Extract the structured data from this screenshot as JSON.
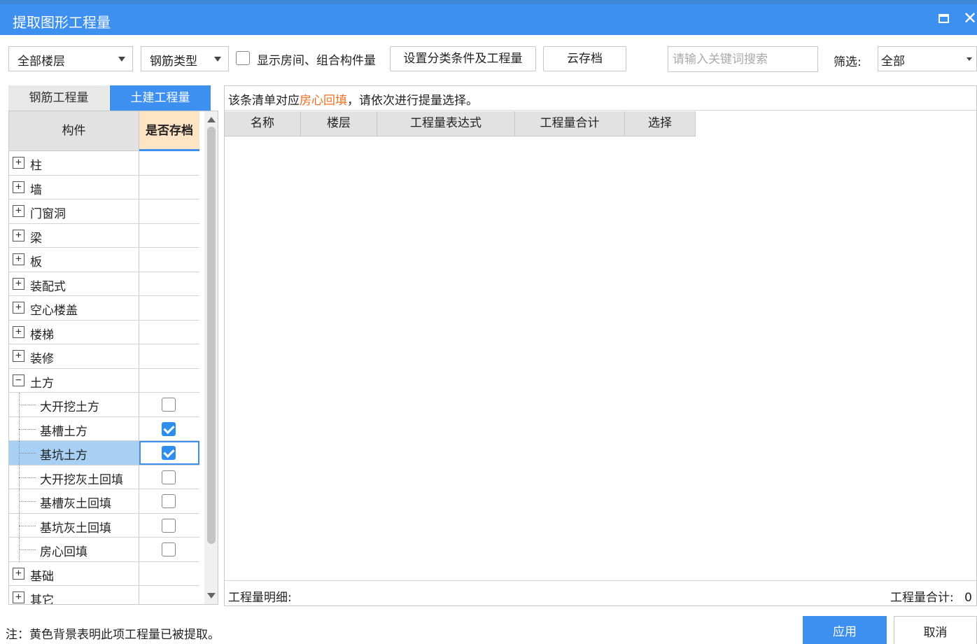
{
  "window": {
    "title": "提取图形工程量"
  },
  "toolbar": {
    "floor_dropdown": "全部楼层",
    "rebar_type_dropdown": "钢筋类型",
    "show_rooms_checkbox": "显示房间、组合构件量",
    "set_conditions_button": "设置分类条件及工程量",
    "cloud_save_button": "云存档",
    "search_placeholder": "请输入关键词搜索",
    "filter_label": "筛选:",
    "filter_value": "全部"
  },
  "tabs": {
    "rebar": "钢筋工程量",
    "civil": "土建工程量"
  },
  "tree": {
    "header_component": "构件",
    "header_archive": "是否存档",
    "rows": [
      {
        "label": "柱",
        "type": "group",
        "expander": "+"
      },
      {
        "label": "墙",
        "type": "group",
        "expander": "+"
      },
      {
        "label": "门窗洞",
        "type": "group",
        "expander": "+"
      },
      {
        "label": "梁",
        "type": "group",
        "expander": "+"
      },
      {
        "label": "板",
        "type": "group",
        "expander": "+"
      },
      {
        "label": "装配式",
        "type": "group",
        "expander": "+"
      },
      {
        "label": "空心楼盖",
        "type": "group",
        "expander": "+"
      },
      {
        "label": "楼梯",
        "type": "group",
        "expander": "+"
      },
      {
        "label": "装修",
        "type": "group",
        "expander": "+"
      },
      {
        "label": "土方",
        "type": "group",
        "expander": "−"
      },
      {
        "label": "大开挖土方",
        "type": "child",
        "checked": false
      },
      {
        "label": "基槽土方",
        "type": "child",
        "checked": true
      },
      {
        "label": "基坑土方",
        "type": "child",
        "checked": true,
        "selected": true
      },
      {
        "label": "大开挖灰土回填",
        "type": "child",
        "checked": false
      },
      {
        "label": "基槽灰土回填",
        "type": "child",
        "checked": false
      },
      {
        "label": "基坑灰土回填",
        "type": "child",
        "checked": false
      },
      {
        "label": "房心回填",
        "type": "child",
        "checked": false
      },
      {
        "label": "基础",
        "type": "group",
        "expander": "+"
      },
      {
        "label": "其它",
        "type": "group",
        "expander": "+"
      }
    ]
  },
  "right_panel": {
    "note_prefix": "该条清单对应",
    "note_highlight": "房心回填",
    "note_suffix": "，请依次进行提量选择。",
    "columns": [
      "名称",
      "楼层",
      "工程量表达式",
      "工程量合计",
      "选择"
    ],
    "detail_label": "工程量明细:",
    "total_label": "工程量合计:",
    "total_value": "0"
  },
  "footer": {
    "note": "注：黄色背景表明此项工程量已被提取。",
    "apply_button": "应用",
    "cancel_button": "取消"
  },
  "colors": {
    "accent": "#3d8ff0",
    "highlight": "#f07020",
    "archived_bg": "#fce4c4"
  }
}
